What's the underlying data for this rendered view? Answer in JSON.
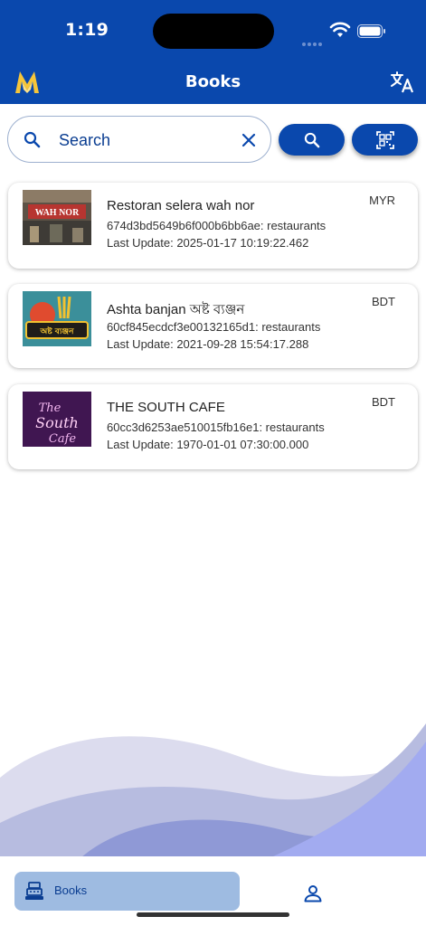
{
  "status_bar": {
    "time": "1:19"
  },
  "header": {
    "title": "Books",
    "logo_icon": "m-logo-icon",
    "translate_icon": "translate-icon"
  },
  "search": {
    "placeholder": "Search",
    "value": ""
  },
  "buttons": {
    "search_icon": "search-icon",
    "qr_icon": "qr-scan-icon"
  },
  "books": [
    {
      "name": "Restoran selera wah nor",
      "id_line": "674d3bd5649b6f000b6bb6ae: restaurants",
      "last_update": "Last Update: 2025-01-17 10:19:22.462",
      "currency": "MYR",
      "thumb_text": "WAH NOR"
    },
    {
      "name": " Ashta banjan অষ্ট ব্যঞ্জন",
      "id_line": "60cf845ecdcf3e00132165d1: restaurants",
      "last_update": "Last Update: 2021-09-28 15:54:17.288",
      "currency": "BDT",
      "thumb_text": "অষ্ট ব্যঞ্জন"
    },
    {
      "name": "THE SOUTH CAFE",
      "id_line": "60cc3d6253ae510015fb16e1: restaurants",
      "last_update": "Last Update: 1970-01-01 07:30:00.000",
      "currency": "BDT",
      "thumb_text": "The South Cafe"
    }
  ],
  "bottom_nav": {
    "books_label": "Books",
    "books_icon": "cash-register-icon",
    "profile_icon": "person-icon"
  },
  "colors": {
    "primary": "#0a48ad",
    "nav_active": "#9ebbe1"
  }
}
